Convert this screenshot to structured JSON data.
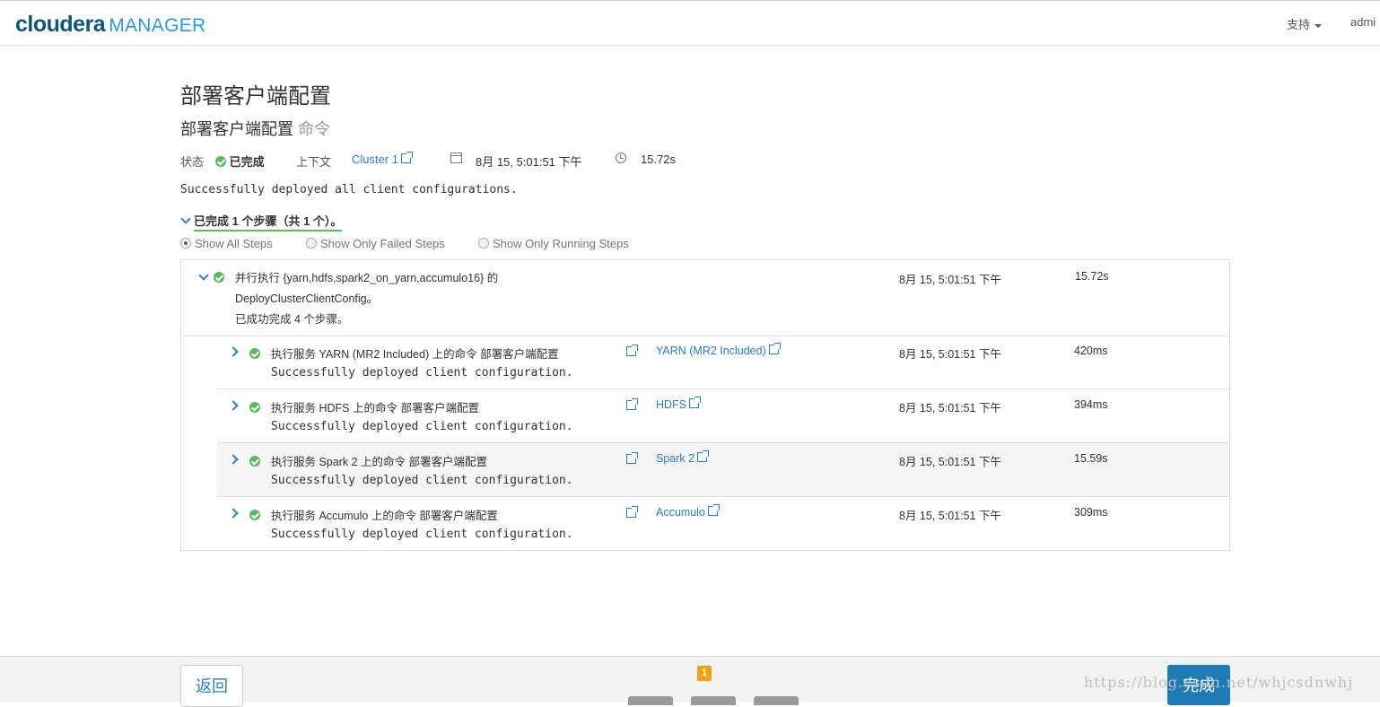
{
  "header": {
    "logo_brand": "cloudera",
    "logo_product": "MANAGER",
    "support_label": "支持",
    "user_label": "admi"
  },
  "page": {
    "title": "部署客户端配置",
    "subtitle_main": "部署客户端配置",
    "subtitle_muted": "命令"
  },
  "status": {
    "label": "状态",
    "value": "已完成",
    "context_label": "上下文",
    "context_link": "Cluster 1",
    "start_time": "8月 15, 5:01:51 下午",
    "duration": "15.72s"
  },
  "message": "Successfully deployed all client configurations.",
  "steps_summary": "已完成 1 个步骤（共 1 个）。",
  "filters": [
    {
      "label": "Show All Steps",
      "checked": true
    },
    {
      "label": "Show Only Failed Steps",
      "checked": false
    },
    {
      "label": "Show Only Running Steps",
      "checked": false
    }
  ],
  "parent_step": {
    "line1": "并行执行 {yarn,hdfs,spark2_on_yarn,accumulo16} 的",
    "line2": "DeployClusterClientConfig。",
    "line3": "已成功完成 4 个步骤。",
    "time": "8月 15, 5:01:51 下午",
    "duration": "15.72s"
  },
  "child_steps": [
    {
      "command": "执行服务 YARN (MR2 Included) 上的命令 部署客户端配置",
      "output": "Successfully deployed client configuration.",
      "service": "YARN (MR2 Included)",
      "time": "8月 15, 5:01:51 下午",
      "duration": "420ms"
    },
    {
      "command": "执行服务 HDFS 上的命令 部署客户端配置",
      "output": "Successfully deployed client configuration.",
      "service": "HDFS",
      "time": "8月 15, 5:01:51 下午",
      "duration": "394ms"
    },
    {
      "command": "执行服务 Spark 2 上的命令 部署客户端配置",
      "output": "Successfully deployed client configuration.",
      "service": "Spark 2",
      "time": "8月 15, 5:01:51 下午",
      "duration": "15.59s"
    },
    {
      "command": "执行服务 Accumulo 上的命令 部署客户端配置",
      "output": "Successfully deployed client configuration.",
      "service": "Accumulo",
      "time": "8月 15, 5:01:51 下午",
      "duration": "309ms"
    }
  ],
  "footer": {
    "back_label": "返回",
    "page_badge": "1",
    "finish_label": "完成",
    "watermark": "https://blog.csdn.net/whjcsdnwhj"
  },
  "colors": {
    "brand": "#10576f",
    "accent": "#2f7dbd",
    "success": "#5cb85c",
    "primary_button": "#1c7cb3",
    "badge": "#f0a30a"
  }
}
